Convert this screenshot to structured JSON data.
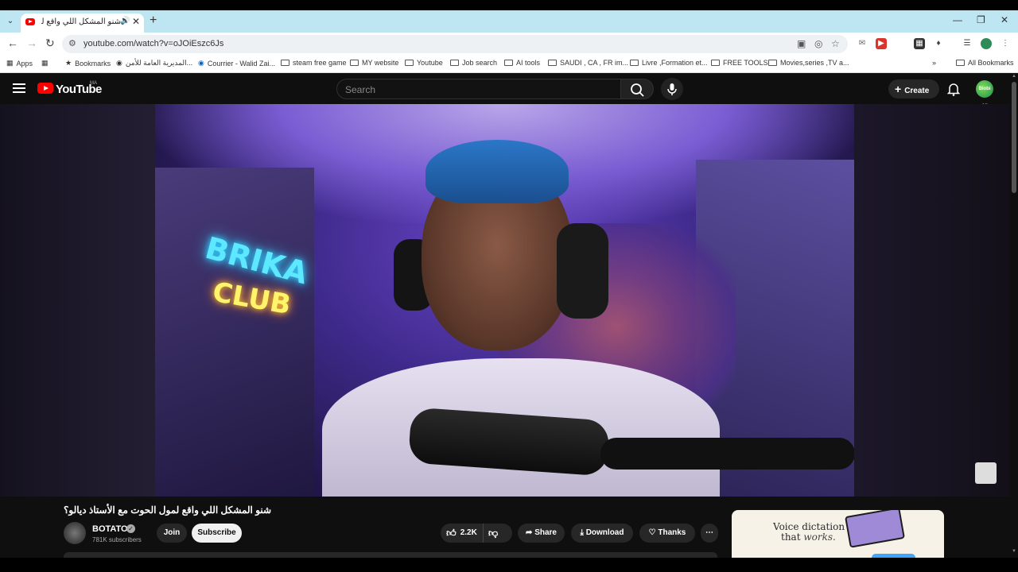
{
  "browser": {
    "tab_title": "شنو المشكل اللي واقع لمول",
    "url": "youtube.com/watch?v=oJOiEszc6Js",
    "bookmarks": [
      "Apps",
      "Bookmarks",
      "المديرية العامة للأمن...",
      "Courrier - Walid Zai...",
      "steam free game",
      "MY website",
      "Youtube",
      "Job search",
      "AI tools",
      "SAUDI , CA , FR im...",
      "Livre ,Formation et...",
      "FREE TOOLS",
      "Movies,series ,TV a...",
      "All Bookmarks"
    ]
  },
  "youtube": {
    "logo_text": "YouTube",
    "country_code": "MA",
    "search_placeholder": "Search",
    "create_label": "Create",
    "avatar_text": "Biobi All"
  },
  "video": {
    "title": "شنو المشكل اللي واقع لمول الحوت مع الأستاذ ديالو؟",
    "neon_top": "BRIKA",
    "neon_bottom": "CLUB",
    "channel_name": "BOTATO",
    "subscribers": "781K subscribers",
    "join_label": "Join",
    "subscribe_label": "Subscribe",
    "likes": "2.2K",
    "share_label": "Share",
    "download_label": "Download",
    "thanks_label": "Thanks"
  },
  "ad": {
    "line1": "Voice dictation",
    "line2_plain": "that ",
    "line2_italic": "works."
  }
}
